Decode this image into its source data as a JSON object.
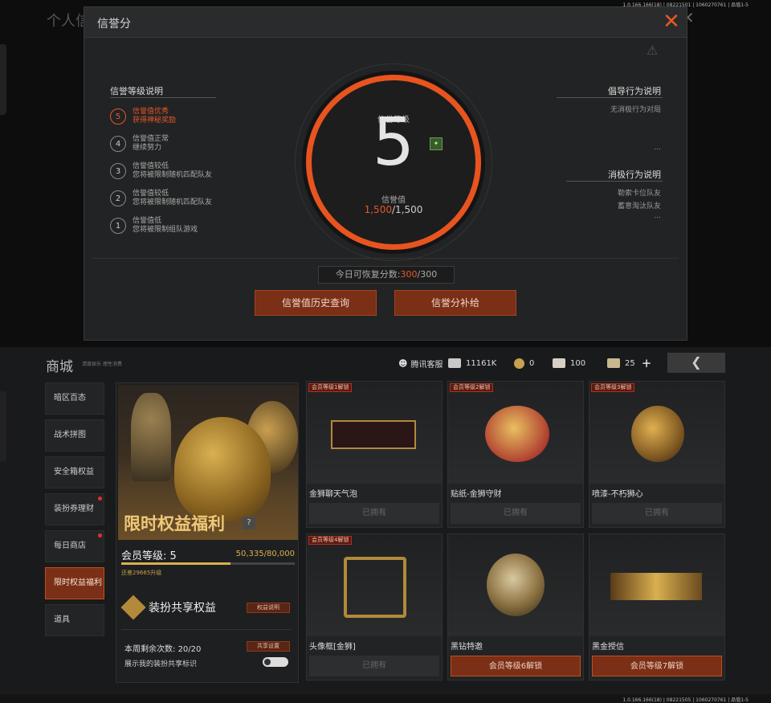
{
  "version_top": "1.0.166.166(18) | 08221501 | 1060270761 | 品值1-5",
  "version_bottom": "1.0.166.166(18) | 08221505 | 1060270761 | 品值1-5",
  "bg_title": "个人信",
  "dialog": {
    "title": "信誉分",
    "close_icon": "close-icon",
    "level_section_title": "信誉等级说明",
    "levels": [
      {
        "num": "5",
        "line1": "信誉值优秀",
        "line2": "获得神秘奖励",
        "active": true
      },
      {
        "num": "4",
        "line1": "信誉值正常",
        "line2": "继续努力",
        "active": false
      },
      {
        "num": "3",
        "line1": "信誉值较低",
        "line2": "您将被限制随机匹配队友",
        "active": false
      },
      {
        "num": "2",
        "line1": "信誉值较低",
        "line2": "您将被限制随机匹配队友",
        "active": false
      },
      {
        "num": "1",
        "line1": "信誉值低",
        "line2": "您将被限制组队游戏",
        "active": false
      }
    ],
    "ring": {
      "label_top": "信誉等级",
      "level": "5",
      "label_bottom": "信誉值",
      "value": "1,500",
      "max": "/1,500"
    },
    "guide_title": "倡导行为说明",
    "guide_items": [
      "无消极行为对局",
      "..."
    ],
    "negative_title": "消极行为说明",
    "negative_items": [
      "勒索卡位队友",
      "蓄意淘汰队友",
      "..."
    ],
    "recover": {
      "label": "今日可恢复分数:",
      "value": "300",
      "max": "/300"
    },
    "btn_history": "信誉值历史查询",
    "btn_supply": "信誉分补给"
  },
  "shop": {
    "title": "商城",
    "subtitle": "请度娱乐 理性消费",
    "service": "腾讯客服",
    "currencies": [
      {
        "icon": "cash-icon",
        "value": "11161K"
      },
      {
        "icon": "coin-icon",
        "value": "0"
      },
      {
        "icon": "ticket-icon",
        "value": "100"
      },
      {
        "icon": "voucher-icon",
        "value": "25"
      }
    ],
    "plus": "+",
    "back_icon": "back-arrow-icon",
    "sidebar": [
      "暗区百态",
      "战术拼图",
      "安全箱权益",
      "装扮券理财",
      "每日商店",
      "限时权益福利",
      "道具"
    ],
    "promo": {
      "title": "限时权益福利",
      "help": "?",
      "member_level_label": "会员等级:",
      "member_level": "5",
      "xp": "50,335/80,000",
      "xp_fraction": 0.63,
      "upgrade": "还差29665升级",
      "share_title": "装扮共享权益",
      "rights_btn": "权益说明",
      "weekly_label": "本周剩余次数:",
      "weekly_value": "20/20",
      "share_settings": "共享设置",
      "show_label": "展示我的装扮共享标识"
    },
    "cards": [
      {
        "tag": "会员等级1解锁",
        "name": "金狮聊天气泡",
        "status": "已拥有",
        "locked": false
      },
      {
        "tag": "会员等级2解锁",
        "name": "贴纸-金狮守财",
        "status": "已拥有",
        "locked": false
      },
      {
        "tag": "会员等级3解锁",
        "name": "喷漆-不朽狮心",
        "status": "已拥有",
        "locked": false
      },
      {
        "tag": "会员等级4解锁",
        "name": "头像框[金狮]",
        "status": "已拥有",
        "locked": false
      },
      {
        "tag": "",
        "name": "黑钻特邀",
        "status": "会员等级6解锁",
        "locked": true
      },
      {
        "tag": "",
        "name": "黑金授信",
        "status": "会员等级7解锁",
        "locked": true
      }
    ]
  }
}
